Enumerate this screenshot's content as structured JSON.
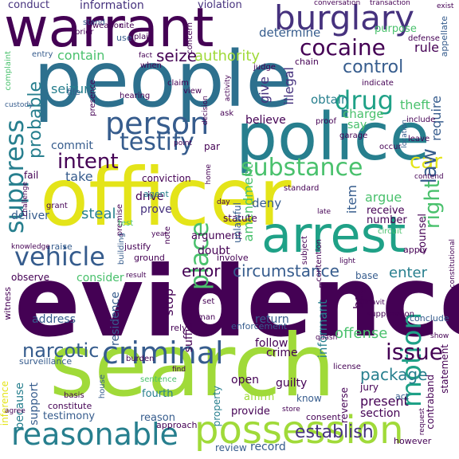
{
  "palette": {
    "dark_purple": "#440154",
    "indigo": "#46327e",
    "blue": "#365c8d",
    "teal_blue": "#277f8e",
    "teal": "#1fa187",
    "green": "#4ac16d",
    "lime": "#a0da39",
    "yellow": "#e4e419"
  },
  "words": [
    {
      "text": "evidence",
      "color": "#440154"
    },
    {
      "text": "search",
      "color": "#a0da39"
    },
    {
      "text": "officer",
      "color": "#e4e419"
    },
    {
      "text": "people",
      "color": "#2d708e"
    },
    {
      "text": "police",
      "color": "#277f8e"
    },
    {
      "text": "warrant",
      "color": "#440154"
    },
    {
      "text": "arrest",
      "color": "#1fa187"
    },
    {
      "text": "possession",
      "color": "#a0da39"
    },
    {
      "text": "reasonable",
      "color": "#277f8e"
    },
    {
      "text": "burglary",
      "color": "#46327e"
    },
    {
      "text": "motion",
      "color": "#1fa187"
    },
    {
      "text": "criminal",
      "color": "#365c8d"
    },
    {
      "text": "person",
      "color": "#365c8d"
    },
    {
      "text": "vehicle",
      "color": "#365c8d"
    },
    {
      "text": "cocaine",
      "color": "#440154"
    },
    {
      "text": "drug",
      "color": "#1fa187"
    },
    {
      "text": "substance",
      "color": "#4ac16d"
    },
    {
      "text": "testify",
      "color": "#365c8d"
    },
    {
      "text": "suppress",
      "color": "#277f8e"
    },
    {
      "text": "place",
      "color": "#4ac16d"
    },
    {
      "text": "control",
      "color": "#365c8d"
    },
    {
      "text": "narcotic",
      "color": "#365c8d"
    },
    {
      "text": "issue",
      "color": "#440154"
    },
    {
      "text": "circumstance",
      "color": "#365c8d"
    },
    {
      "text": "intent",
      "color": "#440154"
    },
    {
      "text": "car",
      "color": "#e4e419"
    },
    {
      "text": "right",
      "color": "#4ac16d"
    },
    {
      "text": "law",
      "color": "#365c8d"
    },
    {
      "text": "establish",
      "color": "#46327e"
    },
    {
      "text": "package",
      "color": "#277f8e"
    },
    {
      "text": "information",
      "color": "#46327e"
    },
    {
      "text": "conduct",
      "color": "#46327e"
    },
    {
      "text": "violation",
      "color": "#46327e"
    },
    {
      "text": "seize",
      "color": "#440154"
    },
    {
      "text": "authority",
      "color": "#a0da39"
    },
    {
      "text": "determine",
      "color": "#365c8d"
    },
    {
      "text": "contain",
      "color": "#4ac16d"
    },
    {
      "text": "rule",
      "color": "#440154"
    },
    {
      "text": "purpose",
      "color": "#4ac16d"
    },
    {
      "text": "probable",
      "color": "#277f8e"
    },
    {
      "text": "seizure",
      "color": "#277f8e"
    },
    {
      "text": "give",
      "color": "#46327e"
    },
    {
      "text": "illegal",
      "color": "#46327e"
    },
    {
      "text": "obtain",
      "color": "#277f8e"
    },
    {
      "text": "theft",
      "color": "#4ac16d"
    },
    {
      "text": "require",
      "color": "#365c8d"
    },
    {
      "text": "charge",
      "color": "#4ac16d"
    },
    {
      "text": "say",
      "color": "#4ac16d"
    },
    {
      "text": "believe",
      "color": "#440154"
    },
    {
      "text": "commit",
      "color": "#365c8d"
    },
    {
      "text": "take",
      "color": "#365c8d"
    },
    {
      "text": "amendment",
      "color": "#4ac16d"
    },
    {
      "text": "item",
      "color": "#365c8d"
    },
    {
      "text": "argue",
      "color": "#4ac16d"
    },
    {
      "text": "deny",
      "color": "#365c8d"
    },
    {
      "text": "prove",
      "color": "#46327e"
    },
    {
      "text": "receive",
      "color": "#440154"
    },
    {
      "text": "deliver",
      "color": "#365c8d"
    },
    {
      "text": "steal",
      "color": "#277f8e"
    },
    {
      "text": "argument",
      "color": "#440154"
    },
    {
      "text": "number",
      "color": "#440154"
    },
    {
      "text": "counsel",
      "color": "#440154"
    },
    {
      "text": "enter",
      "color": "#277f8e"
    },
    {
      "text": "error",
      "color": "#440154"
    },
    {
      "text": "doubt",
      "color": "#440154"
    },
    {
      "text": "consider",
      "color": "#4ac16d"
    },
    {
      "text": "base",
      "color": "#365c8d"
    },
    {
      "text": "bag",
      "color": "#440154"
    },
    {
      "text": "informant",
      "color": "#277f8e"
    },
    {
      "text": "stop",
      "color": "#440154"
    },
    {
      "text": "address",
      "color": "#365c8d"
    },
    {
      "text": "residence",
      "color": "#365c8d"
    },
    {
      "text": "sufficient",
      "color": "#440154"
    },
    {
      "text": "return",
      "color": "#365c8d"
    },
    {
      "text": "follow",
      "color": "#440154"
    },
    {
      "text": "offense",
      "color": "#4ac16d"
    },
    {
      "text": "crime",
      "color": "#440154"
    },
    {
      "text": "because",
      "color": "#277f8e"
    },
    {
      "text": "support",
      "color": "#365c8d"
    },
    {
      "text": "fourth",
      "color": "#277f8e"
    },
    {
      "text": "testimony",
      "color": "#365c8d"
    },
    {
      "text": "reason",
      "color": "#365c8d"
    },
    {
      "text": "open",
      "color": "#440154"
    },
    {
      "text": "guilty",
      "color": "#440154"
    },
    {
      "text": "present",
      "color": "#440154"
    },
    {
      "text": "section",
      "color": "#440154"
    },
    {
      "text": "jury",
      "color": "#440154"
    },
    {
      "text": "affirm",
      "color": "#a0da39"
    },
    {
      "text": "provide",
      "color": "#440154"
    },
    {
      "text": "record",
      "color": "#365c8d"
    },
    {
      "text": "know",
      "color": "#365c8d"
    },
    {
      "text": "review",
      "color": "#365c8d"
    },
    {
      "text": "reverse",
      "color": "#440154"
    },
    {
      "text": "contraband",
      "color": "#440154"
    },
    {
      "text": "statement",
      "color": "#440154"
    },
    {
      "text": "inference",
      "color": "#e4e419"
    },
    {
      "text": "witness",
      "color": "#440154"
    },
    {
      "text": "observe",
      "color": "#440154"
    },
    {
      "text": "surveillance",
      "color": "#365c8d"
    },
    {
      "text": "property",
      "color": "#277f8e"
    },
    {
      "text": "approach",
      "color": "#440154"
    },
    {
      "text": "constitute",
      "color": "#440154"
    },
    {
      "text": "basis",
      "color": "#440154"
    },
    {
      "text": "however",
      "color": "#440154"
    },
    {
      "text": "drive",
      "color": "#440154"
    },
    {
      "text": "conviction",
      "color": "#440154"
    },
    {
      "text": "agent",
      "color": "#277f8e"
    },
    {
      "text": "grant",
      "color": "#440154"
    },
    {
      "text": "fail",
      "color": "#440154"
    },
    {
      "text": "premise",
      "color": "#440154"
    },
    {
      "text": "building",
      "color": "#365c8d"
    },
    {
      "text": "statute",
      "color": "#440154"
    },
    {
      "text": "unlawful",
      "color": "#365c8d"
    },
    {
      "text": "standard",
      "color": "#440154"
    },
    {
      "text": "raise",
      "color": "#365c8d"
    },
    {
      "text": "justify",
      "color": "#440154"
    },
    {
      "text": "ground",
      "color": "#440154"
    },
    {
      "text": "involve",
      "color": "#440154"
    },
    {
      "text": "contention",
      "color": "#440154"
    },
    {
      "text": "subject",
      "color": "#440154"
    },
    {
      "text": "enforcement",
      "color": "#365c8d"
    },
    {
      "text": "apply",
      "color": "#440154"
    },
    {
      "text": "conclude",
      "color": "#365c8d"
    },
    {
      "text": "suppression",
      "color": "#440154"
    },
    {
      "text": "license",
      "color": "#440154"
    },
    {
      "text": "act",
      "color": "#365c8d"
    },
    {
      "text": "consent",
      "color": "#440154"
    },
    {
      "text": "sentence",
      "color": "#4ac16d"
    },
    {
      "text": "burden",
      "color": "#440154"
    },
    {
      "text": "house",
      "color": "#365c8d"
    },
    {
      "text": "rely",
      "color": "#440154"
    },
    {
      "text": "man",
      "color": "#440154"
    },
    {
      "text": "set",
      "color": "#440154"
    },
    {
      "text": "box",
      "color": "#440154"
    },
    {
      "text": "stand",
      "color": "#365c8d"
    },
    {
      "text": "weapon",
      "color": "#440154"
    },
    {
      "text": "prior",
      "color": "#440154"
    },
    {
      "text": "cite",
      "color": "#440154"
    },
    {
      "text": "plain",
      "color": "#440154"
    },
    {
      "text": "use",
      "color": "#365c8d"
    },
    {
      "text": "concern",
      "color": "#440154"
    },
    {
      "text": "entry",
      "color": "#365c8d"
    },
    {
      "text": "complaint",
      "color": "#4ac16d"
    },
    {
      "text": "chain",
      "color": "#440154"
    },
    {
      "text": "judge",
      "color": "#440154"
    },
    {
      "text": "when",
      "color": "#440154"
    },
    {
      "text": "fact",
      "color": "#440154"
    },
    {
      "text": "claim",
      "color": "#440154"
    },
    {
      "text": "file",
      "color": "#365c8d"
    },
    {
      "text": "presence",
      "color": "#440154"
    },
    {
      "text": "hearing",
      "color": "#440154"
    },
    {
      "text": "view",
      "color": "#440154"
    },
    {
      "text": "activity",
      "color": "#440154"
    },
    {
      "text": "decision",
      "color": "#440154"
    },
    {
      "text": "ask",
      "color": "#440154"
    },
    {
      "text": "proof",
      "color": "#440154"
    },
    {
      "text": "garage",
      "color": "#440154"
    },
    {
      "text": "indicate",
      "color": "#440154"
    },
    {
      "text": "include",
      "color": "#440154"
    },
    {
      "text": "occur",
      "color": "#440154"
    },
    {
      "text": "leave",
      "color": "#440154"
    },
    {
      "text": "location",
      "color": "#365c8d"
    },
    {
      "text": "defense",
      "color": "#440154"
    },
    {
      "text": "transaction",
      "color": "#440154"
    },
    {
      "text": "conversation",
      "color": "#440154"
    },
    {
      "text": "appellate",
      "color": "#365c8d"
    },
    {
      "text": "day",
      "color": "#440154"
    },
    {
      "text": "late",
      "color": "#440154"
    },
    {
      "text": "test",
      "color": "#4ac16d"
    },
    {
      "text": "year",
      "color": "#440154"
    },
    {
      "text": "home",
      "color": "#440154"
    },
    {
      "text": "par",
      "color": "#440154"
    },
    {
      "text": "knowledge",
      "color": "#440154"
    },
    {
      "text": "challenge",
      "color": "#440154"
    },
    {
      "text": "point",
      "color": "#440154"
    },
    {
      "text": "circuit",
      "color": "#4ac16d"
    },
    {
      "text": "light",
      "color": "#440154"
    },
    {
      "text": "note",
      "color": "#440154"
    },
    {
      "text": "show",
      "color": "#440154"
    },
    {
      "text": "quash",
      "color": "#440154"
    },
    {
      "text": "affidavit",
      "color": "#440154"
    },
    {
      "text": "constitutional",
      "color": "#440154"
    },
    {
      "text": "result",
      "color": "#440154"
    },
    {
      "text": "custody",
      "color": "#365c8d"
    },
    {
      "text": "agree",
      "color": "#440154"
    },
    {
      "text": "find",
      "color": "#440154"
    },
    {
      "text": "store",
      "color": "#440154"
    },
    {
      "text": "exist",
      "color": "#440154"
    },
    {
      "text": "request",
      "color": "#440154"
    },
    {
      "text": "contend",
      "color": "#440154"
    }
  ]
}
